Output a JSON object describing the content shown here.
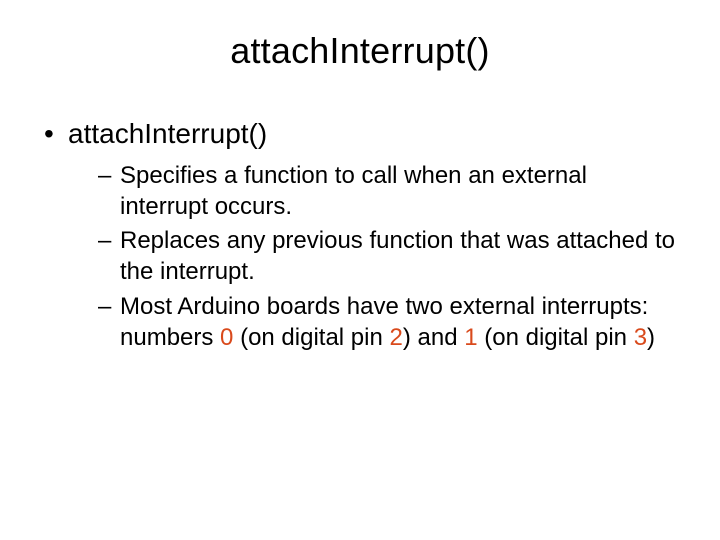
{
  "title": "attachInterrupt()",
  "bullets": {
    "level1": {
      "item0": "attachInterrupt()"
    },
    "level2": {
      "item0": "Specifies a function to call when an external interrupt occurs.",
      "item1": "Replaces any previous function that was attached to the interrupt.",
      "item2_pre": "Most Arduino boards have two external interrupts: numbers ",
      "item2_hl0": "0",
      "item2_mid1": " (on digital pin ",
      "item2_hl1": "2",
      "item2_mid2": ") and ",
      "item2_hl2": "1",
      "item2_mid3": " (on digital pin ",
      "item2_hl3": "3",
      "item2_end": ")"
    }
  }
}
